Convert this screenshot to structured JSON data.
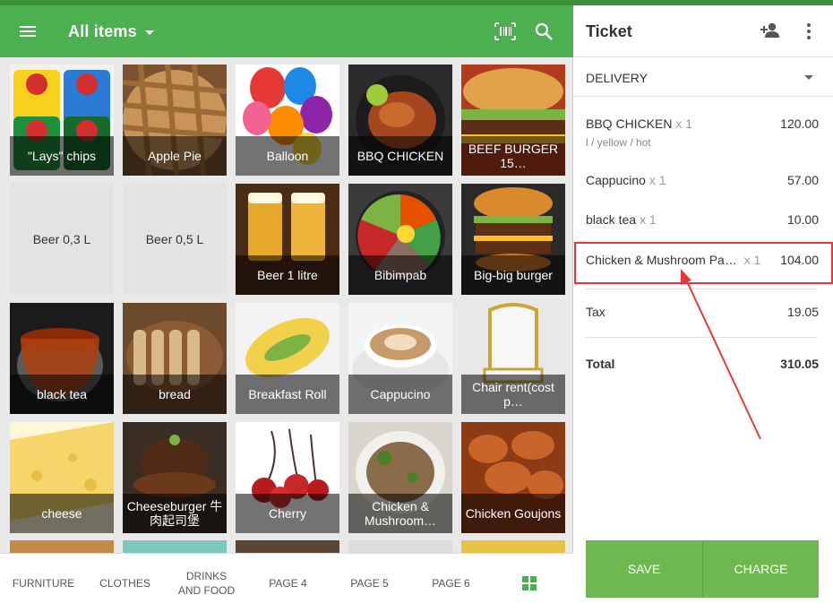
{
  "app": {
    "category_title": "All items",
    "icons": {
      "menu": "menu-icon",
      "barcode": "barcode-icon",
      "search": "search-icon"
    }
  },
  "items": [
    {
      "label": "\"Lays\" chips",
      "art": "chips"
    },
    {
      "label": "Apple Pie",
      "art": "pie"
    },
    {
      "label": "Balloon",
      "art": "balloon"
    },
    {
      "label": "BBQ CHICKEN",
      "art": "chicken"
    },
    {
      "label": "BEEF BURGER 15…",
      "art": "burger"
    },
    {
      "label": "Beer 0,3 L",
      "art": "plain"
    },
    {
      "label": "Beer 0,5 L",
      "art": "plain"
    },
    {
      "label": "Beer 1 litre",
      "art": "beer"
    },
    {
      "label": "Bibimpab",
      "art": "bowl"
    },
    {
      "label": "Big-big burger",
      "art": "bigburger"
    },
    {
      "label": "black tea",
      "art": "tea"
    },
    {
      "label": "bread",
      "art": "bread"
    },
    {
      "label": "Breakfast Roll",
      "art": "roll"
    },
    {
      "label": "Cappucino",
      "art": "coffee"
    },
    {
      "label": "Chair rent(cost p…",
      "art": "chair"
    },
    {
      "label": "cheese",
      "art": "cheese"
    },
    {
      "label": "Cheeseburger 牛肉起司堡",
      "art": "cheeseburger"
    },
    {
      "label": "Cherry",
      "art": "cherry"
    },
    {
      "label": "Chicken & Mushroom…",
      "art": "mushroom"
    },
    {
      "label": "Chicken Goujons",
      "art": "goujons"
    }
  ],
  "tabs": [
    {
      "label": "FURNITURE"
    },
    {
      "label": "CLOTHES"
    },
    {
      "label": "DRINKS AND FOOD"
    },
    {
      "label": "PAGE 4"
    },
    {
      "label": "PAGE 5"
    },
    {
      "label": "PAGE 6"
    },
    {
      "label": "",
      "icon": "grid-icon"
    }
  ],
  "ticket": {
    "title": "Ticket",
    "icons": {
      "add_customer": "add-customer-icon",
      "more": "more-vert-icon"
    },
    "dining_option": "DELIVERY",
    "lines": [
      {
        "name": "BBQ CHICKEN",
        "qty": "x 1",
        "amount": "120.00",
        "modifiers": "l / yellow / hot"
      },
      {
        "name": "Cappucino",
        "qty": "x 1",
        "amount": "57.00"
      },
      {
        "name": "black tea",
        "qty": "x 1",
        "amount": "10.00"
      },
      {
        "name": "Chicken & Mushroom Pa…",
        "qty": "x 1",
        "amount": "104.00"
      }
    ],
    "tax_label": "Tax",
    "tax_amount": "19.05",
    "total_label": "Total",
    "total_amount": "310.05",
    "save_label": "SAVE",
    "charge_label": "CHARGE"
  },
  "colors": {
    "primary": "#4caf50",
    "button": "#6fb84f",
    "annotation": "#e53935"
  }
}
